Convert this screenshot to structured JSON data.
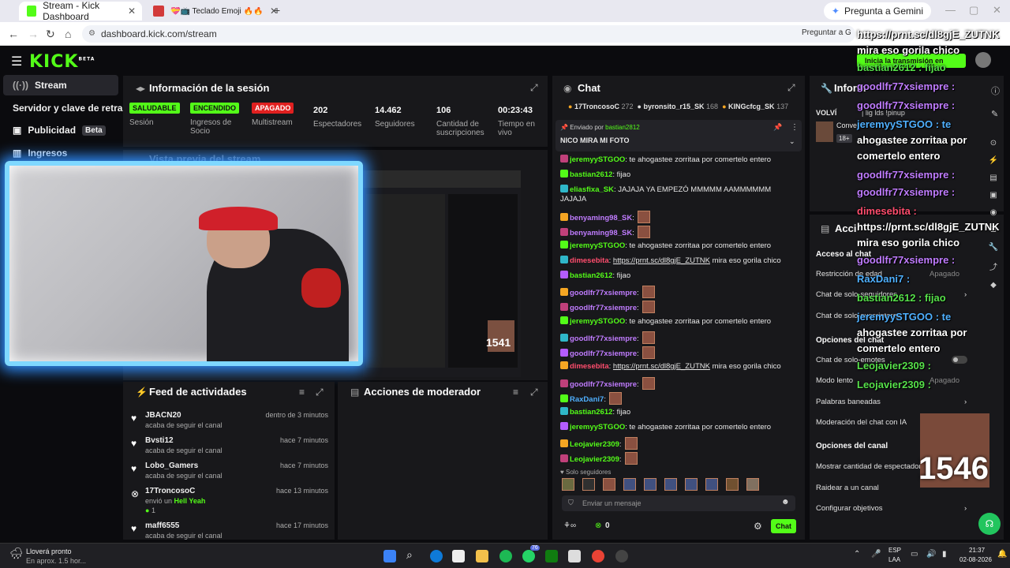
{
  "browser": {
    "tabs": [
      {
        "label": "Stream - Kick Dashboard",
        "active": true
      },
      {
        "label": "💝📺 Teclado Emoji 🔥🔥 39...",
        "active": false
      }
    ],
    "gemini": "Pregunta a Gemini",
    "url": "dashboard.kick.com/stream",
    "ask_gemini": "Preguntar a G"
  },
  "kick": {
    "logo": "KICK",
    "beta_tag": "BETA",
    "go_live": "Inicia la transmisión en directo"
  },
  "sidebar": {
    "items": [
      {
        "label": "Stream"
      },
      {
        "label": "Servidor y clave de retransm"
      },
      {
        "label": "Publicidad",
        "badge": "Beta"
      },
      {
        "label": "Ingresos"
      }
    ]
  },
  "session": {
    "title": "Información de la sesión",
    "stats": [
      {
        "badge": "SALUDABLE",
        "label": "Sesión",
        "color": "#53fc18"
      },
      {
        "badge": "ENCENDIDO",
        "label": "Ingresos de Socio",
        "color": "#53fc18"
      },
      {
        "badge": "APAGADO",
        "label": "Multistream",
        "color": "#e02020"
      },
      {
        "num": "202",
        "label": "Espectadores"
      },
      {
        "num": "14.462",
        "label": "Seguidores"
      },
      {
        "num": "106",
        "label": "Cantidad de suscripciones"
      },
      {
        "num": "00:23:43",
        "label": "Tiempo en vivo"
      }
    ],
    "preview_title": "Vista previa del stream"
  },
  "feed": {
    "title": "Feed de actividades",
    "items": [
      {
        "name": "JBACN20",
        "sub": "acaba de seguir el canal",
        "time": "dentro de 3 minutos"
      },
      {
        "name": "Bvsti12",
        "sub": "acaba de seguir el canal",
        "time": "hace 7 minutos"
      },
      {
        "name": "Lobo_Gamers",
        "sub": "acaba de seguir el canal",
        "time": "hace 7 minutos"
      },
      {
        "name": "17TroncosoC",
        "sub": "envió un",
        "sub2": "Hell Yeah",
        "extra": "1",
        "time": "hace 13 minutos"
      },
      {
        "name": "maff6555",
        "sub": "acaba de seguir el canal",
        "time": "hace 17 minutos"
      }
    ]
  },
  "moderator": {
    "title": "Acciones de moderador"
  },
  "chat": {
    "title": "Chat",
    "top_gifters": [
      {
        "name": "17TroncosoC",
        "count": "272"
      },
      {
        "name": "byronsito_r15_SK",
        "count": "168"
      },
      {
        "name": "KINGcfcg_SK",
        "count": "137"
      }
    ],
    "pinned_by_label": "Enviado por",
    "pinned_by": "bastian2812",
    "pinned_text": "NICO MIRA MI FOTO",
    "messages": [
      {
        "user": "jeremyySTGOO",
        "color": "#53fc18",
        "text": ": te ahogastee zorritaa por comertelo entero"
      },
      {
        "user": "bastian2612",
        "color": "#53fc18",
        "text": ": fijao"
      },
      {
        "user": "eliasfixa_SK",
        "color": "#53fc18",
        "text": ": JAJAJA YA EMPEZÓ MMMMM AAMMMMMM"
      },
      {
        "user": "",
        "color": "#e6e6e6",
        "text": "JAJAJA"
      },
      {
        "user": "benyaming98_SK",
        "color": "#c07cff",
        "text": ":",
        "emote": true
      },
      {
        "user": "benyaming98_SK",
        "color": "#c07cff",
        "text": ":",
        "emote": true
      },
      {
        "user": "jeremyySTGOO",
        "color": "#53fc18",
        "text": ": te ahogastee zorritaa por comertelo entero"
      },
      {
        "user": "dimesebita",
        "color": "#ff4d6d",
        "text": ": ",
        "link": "https://prnt.sc/dl8gjE_ZUTNK",
        "after": " mira eso gorila chico"
      },
      {
        "user": "bastian2612",
        "color": "#53fc18",
        "text": ": fijao"
      },
      {
        "user": "goodlfr77xsiempre",
        "color": "#c07cff",
        "text": ":",
        "emote": true
      },
      {
        "user": "goodlfr77xsiempre",
        "color": "#c07cff",
        "text": ":",
        "emote": true
      },
      {
        "user": "jeremyySTGOO",
        "color": "#53fc18",
        "text": ": te ahogastee zorritaa por comertelo entero"
      },
      {
        "user": "goodlfr77xsiempre",
        "color": "#c07cff",
        "text": ":",
        "emote": true
      },
      {
        "user": "goodlfr77xsiempre",
        "color": "#c07cff",
        "text": ":",
        "emote": true
      },
      {
        "user": "dimesebita",
        "color": "#ff4d6d",
        "text": ": ",
        "link": "https://prnt.sc/dl8gjE_ZUTNK",
        "after": " mira eso gorila chico"
      },
      {
        "user": "goodlfr77xsiempre",
        "color": "#c07cff",
        "text": ":",
        "emote": true
      },
      {
        "user": "RaxDani7",
        "color": "#4fb0ff",
        "text": ":",
        "emote": true
      },
      {
        "user": "bastian2612",
        "color": "#53fc18",
        "text": ": fijao"
      },
      {
        "user": "jeremyySTGOO",
        "color": "#53fc18",
        "text": ": te ahogastee zorritaa por comertelo entero"
      },
      {
        "user": "Leojavier2309",
        "color": "#53fc18",
        "text": ":",
        "emote": true
      },
      {
        "user": "Leojavier2309",
        "color": "#53fc18",
        "text": ":",
        "emote": true
      }
    ],
    "followers_only": "Solo seguidores",
    "input_placeholder": "Enviar un mensaje",
    "points": "0",
    "send_label": "Chat"
  },
  "right_panel": {
    "info_title": "Inform",
    "stream_title_prefix": "VOLVÍ",
    "stream_title_suffix": "| lig lds !pinup",
    "category_prefix": "Conve",
    "age_badge": "18+",
    "actions_title": "Acci",
    "chat_access_head": "Acceso al chat",
    "rows": [
      {
        "label": "Restricción de edad",
        "value": "Apagado"
      },
      {
        "label": "Chat de solo-seguidores"
      },
      {
        "label": "Chat de solo-suscriptores"
      }
    ],
    "chat_options_head": "Opciones del chat",
    "rows2": [
      {
        "label": "Chat de solo-emotes"
      },
      {
        "label": "Modo lento",
        "value": "Apagado"
      },
      {
        "label": "Palabras baneadas"
      },
      {
        "label": "Moderación del chat con IA"
      }
    ],
    "channel_options_head": "Opciones del canal",
    "rows3": [
      {
        "label": "Mostrar cantidad de espectadores"
      },
      {
        "label": "Raidear a un canal"
      },
      {
        "label": "Configurar objetivos"
      }
    ]
  },
  "overlay_chat": [
    {
      "text": "https://prnt.sc/dl8gjE_ZUTNK",
      "cls": "w"
    },
    {
      "text": "mira eso gorila chico",
      "cls": "w"
    },
    {
      "text": "bastian2612 : fijao",
      "cls": "g"
    },
    {
      "text": "goodlfr77xsiempre :",
      "cls": "p"
    },
    {
      "text": "goodlfr77xsiempre :",
      "cls": "p"
    },
    {
      "text": "jeremyySTGOO : te",
      "cls": "c"
    },
    {
      "text": "ahogastee zorritaa por",
      "cls": "w"
    },
    {
      "text": "comertelo entero",
      "cls": "w"
    },
    {
      "text": "goodlfr77xsiempre :",
      "cls": "p"
    },
    {
      "text": "goodlfr77xsiempre :",
      "cls": "p"
    },
    {
      "text": "dimesebita :",
      "cls": "r"
    },
    {
      "text": "https://prnt.sc/dl8gjE_ZUTNK",
      "cls": "w"
    },
    {
      "text": "mira eso gorila chico",
      "cls": "w"
    },
    {
      "text": "goodlfr77xsiempre :",
      "cls": "p"
    },
    {
      "text": "RaxDani7 :",
      "cls": "c"
    },
    {
      "text": "bastian2612 : fijao",
      "cls": "g"
    },
    {
      "text": "jeremyySTGOO : te",
      "cls": "c"
    },
    {
      "text": "ahogastee zorritaa por",
      "cls": "w"
    },
    {
      "text": "comertelo entero",
      "cls": "w"
    },
    {
      "text": "Leojavier2309 :",
      "cls": "g"
    },
    {
      "text": "Leojavier2309 :",
      "cls": "g"
    }
  ],
  "overlay_number": "1546",
  "preview_number": "1541",
  "taskbar": {
    "weather_title": "Lloverá pronto",
    "weather_sub": "En aprox. 1.5 hor...",
    "lang": "ESP",
    "lang2": "LAA",
    "time": "21:37",
    "date": "02-08-2026",
    "whatsapp_badge": "76"
  }
}
